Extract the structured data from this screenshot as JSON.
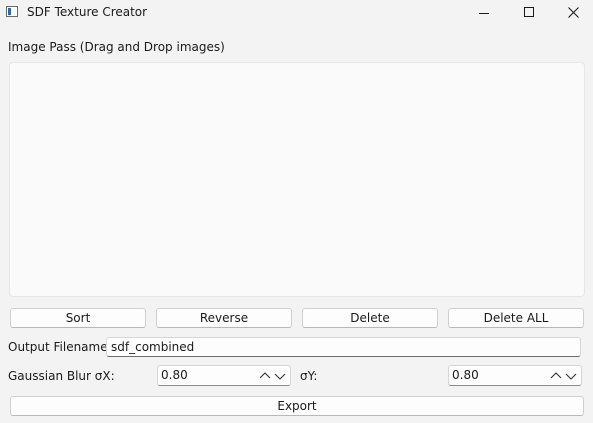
{
  "window": {
    "title": "SDF Texture Creator"
  },
  "image_pass": {
    "label": "Image Pass (Drag and Drop images)"
  },
  "buttons": {
    "sort": "Sort",
    "reverse": "Reverse",
    "delete": "Delete",
    "delete_all": "Delete ALL",
    "export": "Export"
  },
  "output": {
    "label": "Output Filename:",
    "value": "sdf_combined"
  },
  "blur": {
    "x_label": "Gaussian Blur σX:",
    "x_value": "0.80",
    "y_label": "σY:",
    "y_value": "0.80"
  }
}
